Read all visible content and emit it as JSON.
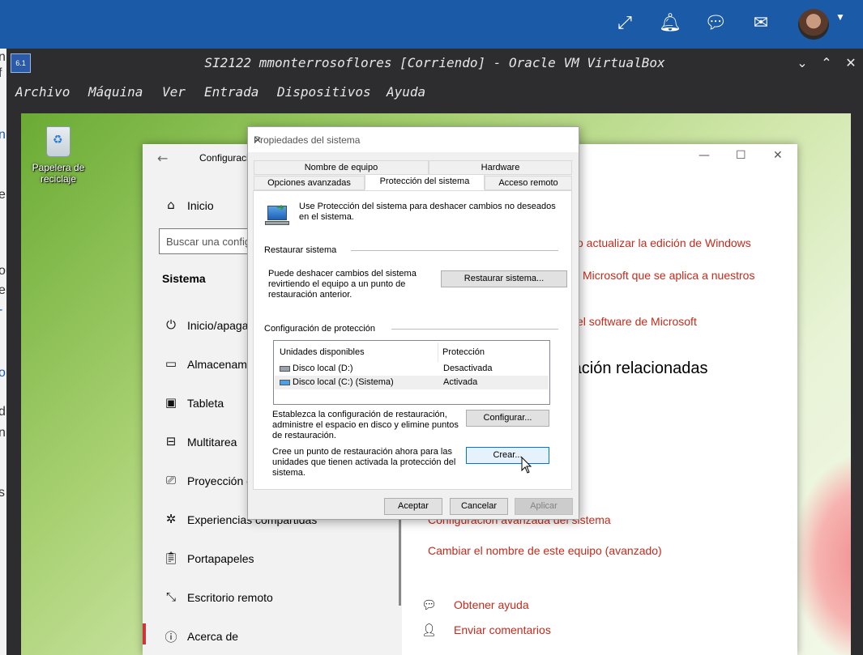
{
  "host_bar": {
    "icons": [
      "expand-icon",
      "bell-icon",
      "chat-icon",
      "mail-icon",
      "avatar",
      "chevron-down-icon"
    ]
  },
  "left_strip": {
    "fragments": [
      "n",
      "f",
      "n",
      "er",
      "ou",
      "el",
      "-",
      "o",
      "d",
      "n",
      "s"
    ]
  },
  "vbox": {
    "title": "SI2122 mmonterrosoflores [Corriendo] - Oracle VM VirtualBox",
    "logo_text": "6.1",
    "menu": [
      "Archivo",
      "Máquina",
      "Ver",
      "Entrada",
      "Dispositivos",
      "Ayuda"
    ],
    "window_controls": [
      "chevron-down-icon",
      "chevron-up-icon",
      "close-icon"
    ]
  },
  "desktop": {
    "recycle_bin_label": "Papelera de reciclaje"
  },
  "settings": {
    "title": "Configuración",
    "home_label": "Inicio",
    "search_placeholder": "Buscar una configuración",
    "section_title": "Sistema",
    "nav": [
      {
        "label": "Inicio/apagado y suspensión",
        "icon": "power-icon"
      },
      {
        "label": "Almacenamiento",
        "icon": "storage-icon"
      },
      {
        "label": "Tableta",
        "icon": "tablet-icon"
      },
      {
        "label": "Multitarea",
        "icon": "multitask-icon"
      },
      {
        "label": "Proyección en este equipo",
        "icon": "projection-icon"
      },
      {
        "label": "Experiencias compartidas",
        "icon": "share-icon"
      },
      {
        "label": "Portapapeles",
        "icon": "clipboard-icon"
      },
      {
        "label": "Escritorio remoto",
        "icon": "remote-desktop-icon"
      },
      {
        "label": "Acerca de",
        "icon": "info-icon"
      }
    ],
    "right": {
      "link1": "o actualizar la edición de Windows",
      "link2": "Microsoft que se aplica a nuestros",
      "link3": "el software de Microsoft",
      "heading": "ración relacionadas",
      "link4": "Configuración avanzada del sistema",
      "link5": "Cambiar el nombre de este equipo (avanzado)",
      "help": "Obtener ayuda",
      "feedback": "Enviar comentarios"
    }
  },
  "dialog": {
    "title": "Propiedades del sistema",
    "tabs_row1": [
      "Nombre de equipo",
      "Hardware"
    ],
    "tabs_row2": [
      "Opciones avanzadas",
      "Protección del sistema",
      "Acceso remoto"
    ],
    "intro": "Use Protección del sistema para deshacer cambios no deseados en el sistema.",
    "restore_group": "Restaurar sistema",
    "restore_text": "Puede deshacer cambios del sistema revirtiendo el equipo a un punto de restauración anterior.",
    "restore_button": "Restaurar sistema...",
    "protection_group": "Configuración de protección",
    "list_headers": [
      "Unidades disponibles",
      "Protección"
    ],
    "drives": [
      {
        "name": "Disco local (D:)",
        "status": "Desactivada"
      },
      {
        "name": "Disco local (C:) (Sistema)",
        "status": "Activada"
      }
    ],
    "configure_text": "Establezca la configuración de restauración, administre el espacio en disco y elimine puntos de restauración.",
    "configure_button": "Configurar...",
    "create_text": "Cree un punto de restauración ahora para las unidades que tienen activada la protección del sistema.",
    "create_button": "Crear...",
    "ok_button": "Aceptar",
    "cancel_button": "Cancelar",
    "apply_button": "Aplicar"
  }
}
